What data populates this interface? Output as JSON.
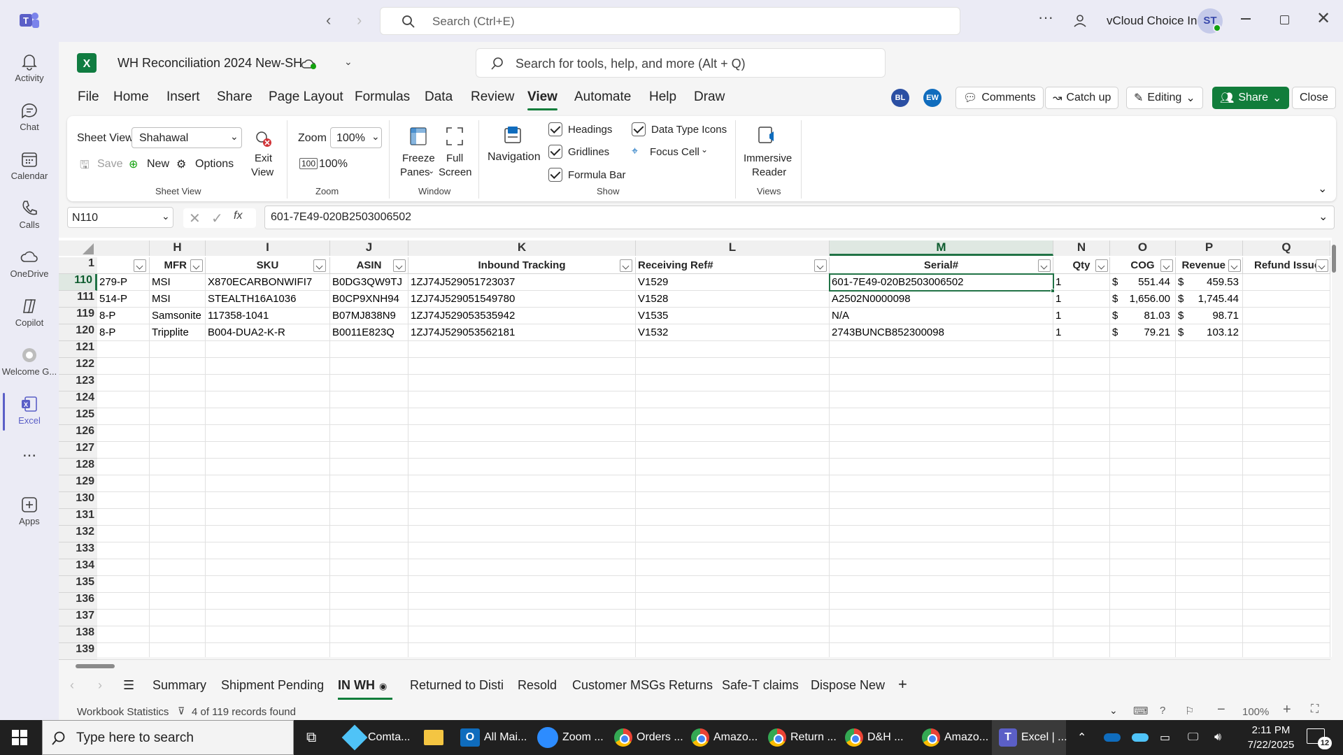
{
  "window": {
    "account": "vCloud Choice Inc.",
    "avatar": "ST",
    "search_placeholder": "Search (Ctrl+E)"
  },
  "rail": [
    {
      "label": "Activity",
      "icon": "bell-icon"
    },
    {
      "label": "Chat",
      "icon": "chat-icon"
    },
    {
      "label": "Calendar",
      "icon": "calendar-icon"
    },
    {
      "label": "Calls",
      "icon": "phone-icon"
    },
    {
      "label": "OneDrive",
      "icon": "cloud-icon"
    },
    {
      "label": "Copilot",
      "icon": "copilot-icon"
    },
    {
      "label": "Welcome G...",
      "icon": "welcome-icon"
    },
    {
      "label": "Excel",
      "icon": "excel-icon"
    },
    {
      "label": "...",
      "icon": "more-icon"
    },
    {
      "label": "Apps",
      "icon": "add-app-icon"
    }
  ],
  "doc": {
    "title": "WH Reconciliation 2024 New-SH",
    "tools_search": "Search for tools, help, and more (Alt + Q)"
  },
  "menu": [
    "File",
    "Home",
    "Insert",
    "Share",
    "Page Layout",
    "Formulas",
    "Data",
    "Review",
    "View",
    "Automate",
    "Help",
    "Draw"
  ],
  "menu_active": "View",
  "collab": [
    "BL",
    "EW"
  ],
  "actions": {
    "comments": "Comments",
    "catchup": "Catch up",
    "editing": "Editing",
    "share": "Share",
    "close": "Close"
  },
  "ribbon": {
    "sheet_view_label": "Sheet View",
    "sheet_view_value": "Shahawal",
    "save": "Save",
    "new": "New",
    "options": "Options",
    "exit_view_1": "Exit",
    "exit_view_2": "View",
    "group_sheet_view": "Sheet View",
    "zoom_label": "Zoom",
    "zoom_value": "100%",
    "zoom_100": "100%",
    "group_zoom": "Zoom",
    "freeze_1": "Freeze",
    "freeze_2": "Panes",
    "full_1": "Full",
    "full_2": "Screen",
    "group_window": "Window",
    "navigation": "Navigation",
    "headings": "Headings",
    "gridlines": "Gridlines",
    "formula_bar": "Formula Bar",
    "data_type_icons": "Data Type Icons",
    "focus_cell": "Focus Cell",
    "group_show": "Show",
    "immersive_1": "Immersive",
    "immersive_2": "Reader",
    "group_views": "Views"
  },
  "formula": {
    "namebox": "N110",
    "fx": "fx",
    "value": "601-7E49-020B2503006502"
  },
  "columns": [
    "H",
    "I",
    "J",
    "K",
    "L",
    "M",
    "N",
    "O",
    "P",
    "Q"
  ],
  "headers": {
    "H": "MFR",
    "I": "SKU",
    "J": "ASIN",
    "K": "Inbound Tracking",
    "L": "Receiving Ref#",
    "M": "Serial#",
    "N": "Qty",
    "O": "COG",
    "P": "Revenue",
    "Q": "Refund Issue"
  },
  "rows": [
    {
      "num": "110",
      "g": "279-P",
      "h": "MSI",
      "i": "X870ECARBONWIFI7",
      "j": "B0DG3QW9TJ",
      "k": "1ZJ74J529051723037",
      "l": "V1529",
      "m": "601-7E49-020B2503006502",
      "n": "1",
      "o_cur": "$",
      "o": "551.44",
      "p_cur": "$",
      "p": "459.53"
    },
    {
      "num": "111",
      "g": "514-P",
      "h": "MSI",
      "i": "STEALTH16A1036",
      "j": "B0CP9XNH94",
      "k": "1ZJ74J529051549780",
      "l": "V1528",
      "m": "A2502N0000098",
      "n": "1",
      "o_cur": "$",
      "o": "1,656.00",
      "p_cur": "$",
      "p": "1,745.44"
    },
    {
      "num": "119",
      "g": "8-P",
      "h": "Samsonite",
      "i": "117358-1041",
      "j": "B07MJ838N9",
      "k": "1ZJ74J529053535942",
      "l": "V1535",
      "m": "N/A",
      "n": "1",
      "o_cur": "$",
      "o": "81.03",
      "p_cur": "$",
      "p": "98.71"
    },
    {
      "num": "120",
      "g": "8-P",
      "h": "Tripplite",
      "i": "B004-DUA2-K-R",
      "j": "B0011E823Q",
      "k": "1ZJ74J529053562181",
      "l": "V1532",
      "m": "2743BUNCB852300098",
      "n": "1",
      "o_cur": "$",
      "o": "79.21",
      "p_cur": "$",
      "p": "103.12"
    }
  ],
  "empty_rows": [
    "121",
    "122",
    "123",
    "124",
    "125",
    "126",
    "127",
    "128",
    "129",
    "130",
    "131",
    "132",
    "133",
    "134",
    "135",
    "136",
    "137",
    "138",
    "139"
  ],
  "header_row": "1",
  "sheet_tabs": [
    "Summary",
    "Shipment Pending",
    "IN WH",
    "Returned to Disti",
    "Resold",
    "Customer MSGs Returns",
    "Safe-T claims",
    "Dispose New"
  ],
  "sheet_tab_active": "IN WH",
  "status": {
    "stats": "Workbook Statistics",
    "filter": "4 of 119 records found",
    "zoom": "100%"
  },
  "taskbar": {
    "search": "Type here to search",
    "items": [
      "Comta...",
      "All Mai...",
      "Zoom ...",
      "Orders ...",
      "Amazo...",
      "Return ...",
      "D&H ...",
      "Amazo...",
      "Excel | ..."
    ],
    "time": "2:11 PM",
    "date": "7/22/2025",
    "notif": "12"
  },
  "colors": {
    "excel_green": "#117d3b",
    "teams_purple": "#5b5fc7",
    "selection": "#217346"
  }
}
